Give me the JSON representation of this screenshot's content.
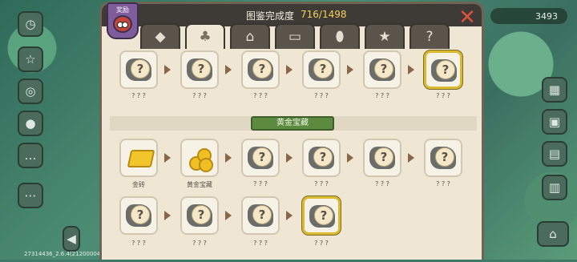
{
  "panel": {
    "title": "图鉴完成度",
    "progress": "716/1498",
    "reward_label": "奖励",
    "close_label": "✕"
  },
  "tabs": [
    {
      "name": "diamond",
      "icon": "◆"
    },
    {
      "name": "clover",
      "icon": "♣"
    },
    {
      "name": "house",
      "icon": "⌂"
    },
    {
      "name": "chest",
      "icon": "▭"
    },
    {
      "name": "egg",
      "icon": "⬮"
    },
    {
      "name": "star",
      "icon": "★"
    },
    {
      "name": "mystery",
      "icon": "?"
    }
  ],
  "top_row": {
    "labels": [
      "? ? ?",
      "? ? ?",
      "? ? ?",
      "? ? ?",
      "? ? ?",
      "? ? ?"
    ]
  },
  "section": {
    "title": "黄金宝藏",
    "row1": [
      "金砖",
      "黄金宝藏",
      "? ? ?",
      "? ? ?",
      "? ? ?",
      "? ? ?"
    ],
    "row2": [
      "? ? ?",
      "? ? ?",
      "? ? ?",
      "? ? ?"
    ]
  },
  "hud": {
    "gem_count": "3493",
    "build_text": "27314436_2.6.4(21200004) _T..."
  }
}
